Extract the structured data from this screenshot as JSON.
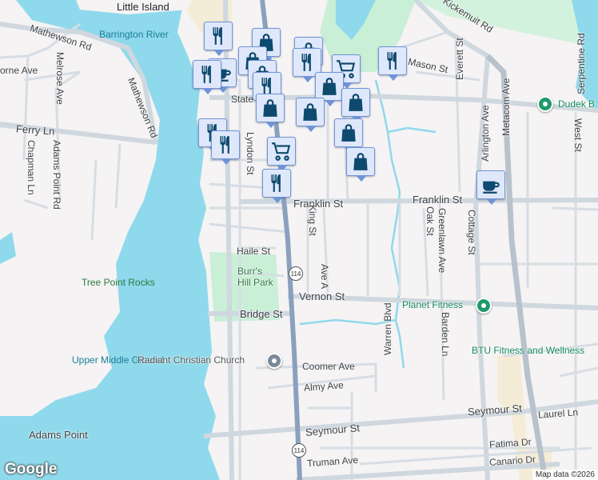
{
  "map": {
    "water_labels": [
      "Barrington River",
      "Upper Middle Ground"
    ],
    "place_labels": [
      "Tree Point Rocks",
      "Adams Point",
      "Little Island"
    ],
    "park_labels": [
      "Burr's Hill Park"
    ],
    "poi_labels": [
      "Dudek B",
      "Planet Fitness",
      "BTU Fitness and Wellness",
      "Radiant Christian Church"
    ],
    "roads": {
      "mathewson1": "Mathewson Rd",
      "mathewson2": "Mathewson Rd",
      "ferry": "Ferry Ln",
      "melrose": "Melrose Ave",
      "orne": "orne Ave",
      "chapman": "Chapman Ln",
      "adams": "Adams Point Rd",
      "state": "State St",
      "lyndon": "Lyndon St",
      "kickemuit": "Kickemuit Rd",
      "mason": "Mason St",
      "everett": "Everett St",
      "arlington": "Arlington Ave",
      "metacom": "Metacom Ave",
      "serpentine": "Serpentine Rd",
      "west": "West St",
      "franklin1": "Franklin St",
      "franklin2": "Franklin St",
      "king": "King St",
      "oak": "Oak St",
      "greenlawn": "Greenlawn Ave",
      "cottage": "Cottage St",
      "haile": "Haile St",
      "avea": "Ave A",
      "vernon": "Vernon St",
      "bridge": "Bridge St",
      "warren": "Warren Blvd",
      "barden": "Barden Ln",
      "coomer": "Coomer Ave",
      "almy": "Almy Ave",
      "seymour1": "Seymour St",
      "seymour2": "Seymour St",
      "laurel": "Laurel Ln",
      "fatima": "Fatima Dr",
      "canario": "Canario Dr",
      "truman": "Truman Ave",
      "route": "114",
      "route2": "114"
    },
    "attribution": "Map data ©2026",
    "logo": "Google",
    "colors": {
      "water": "#8fd9ec",
      "land": "#f5f3f3",
      "park": "#c9efd6",
      "road": "#d2dae2",
      "highway": "#8aa0bd",
      "marker": "#dfe8fb",
      "icon": "#0e4a6e"
    }
  }
}
